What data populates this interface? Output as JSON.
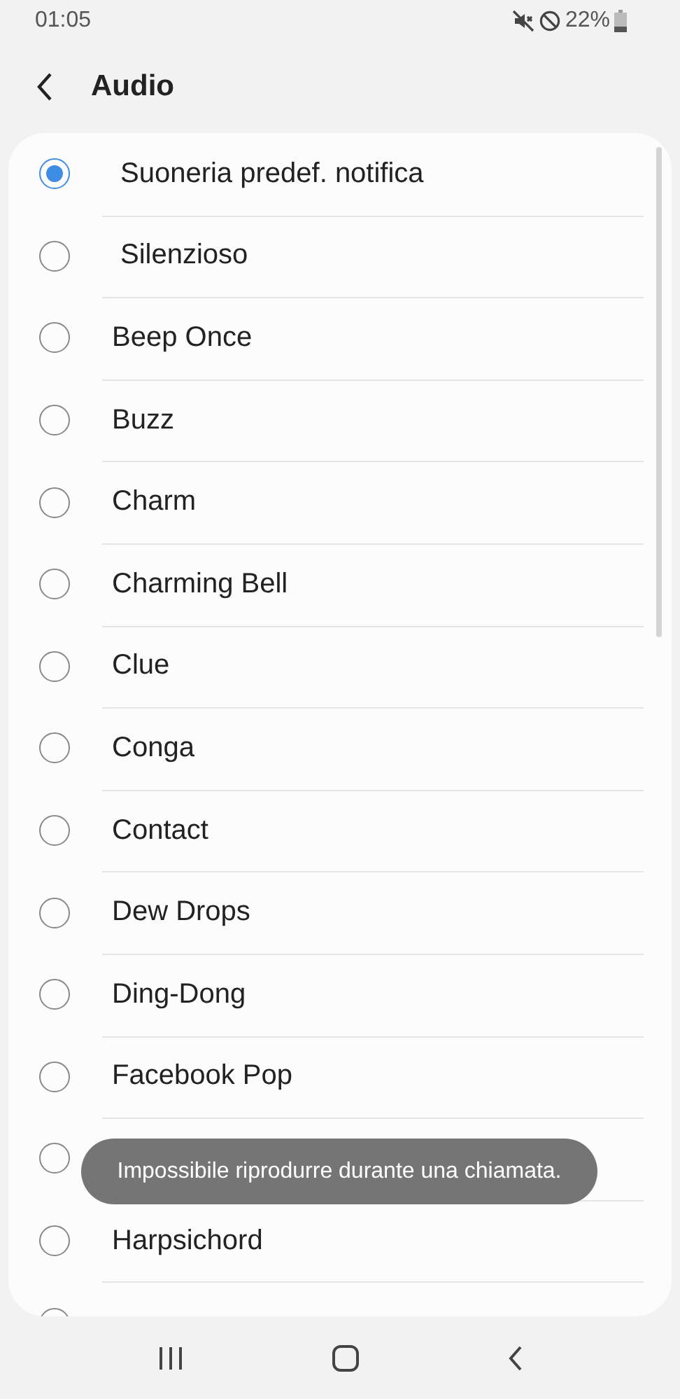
{
  "status_bar": {
    "time": "01:05",
    "battery": "22%"
  },
  "header": {
    "title": "Audio"
  },
  "items": [
    {
      "label": "Suoneria predef. notifica",
      "selected": true
    },
    {
      "label": "Silenzioso",
      "selected": false
    },
    {
      "label": "Beep Once",
      "selected": false
    },
    {
      "label": "Buzz",
      "selected": false
    },
    {
      "label": "Charm",
      "selected": false
    },
    {
      "label": "Charming Bell",
      "selected": false
    },
    {
      "label": "Clue",
      "selected": false
    },
    {
      "label": "Conga",
      "selected": false
    },
    {
      "label": "Contact",
      "selected": false
    },
    {
      "label": "Dew Drops",
      "selected": false
    },
    {
      "label": "Ding-Dong",
      "selected": false
    },
    {
      "label": "Facebook Pop",
      "selected": false
    },
    {
      "selected": false
    },
    {
      "label": "Harpsichord",
      "selected": false
    },
    {
      "selected": false
    }
  ],
  "toast": {
    "message": "Impossibile riprodurre durante una chiamata."
  }
}
